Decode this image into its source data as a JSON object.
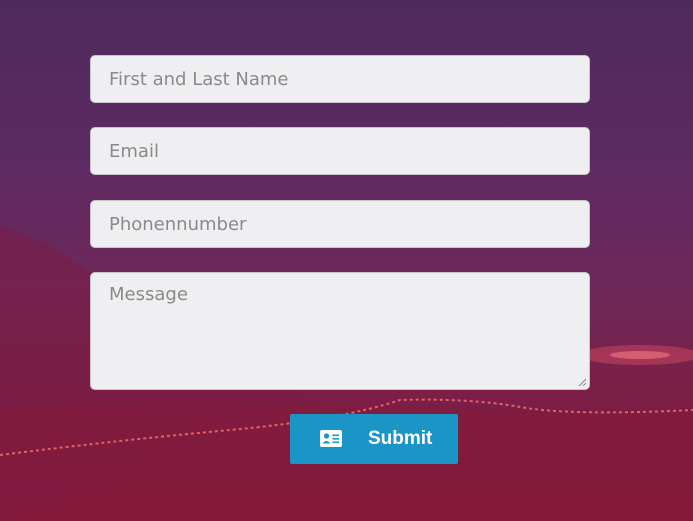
{
  "form": {
    "name_placeholder": "First and Last Name",
    "email_placeholder": "Email",
    "phone_placeholder": "Phonennumber",
    "message_placeholder": "Message",
    "submit_label": "Submit",
    "submit_icon": "contact-card-icon"
  },
  "colors": {
    "submit_button": "#1b95c6",
    "field_background": "#efeff1",
    "placeholder_text": "#8a8a8a"
  }
}
